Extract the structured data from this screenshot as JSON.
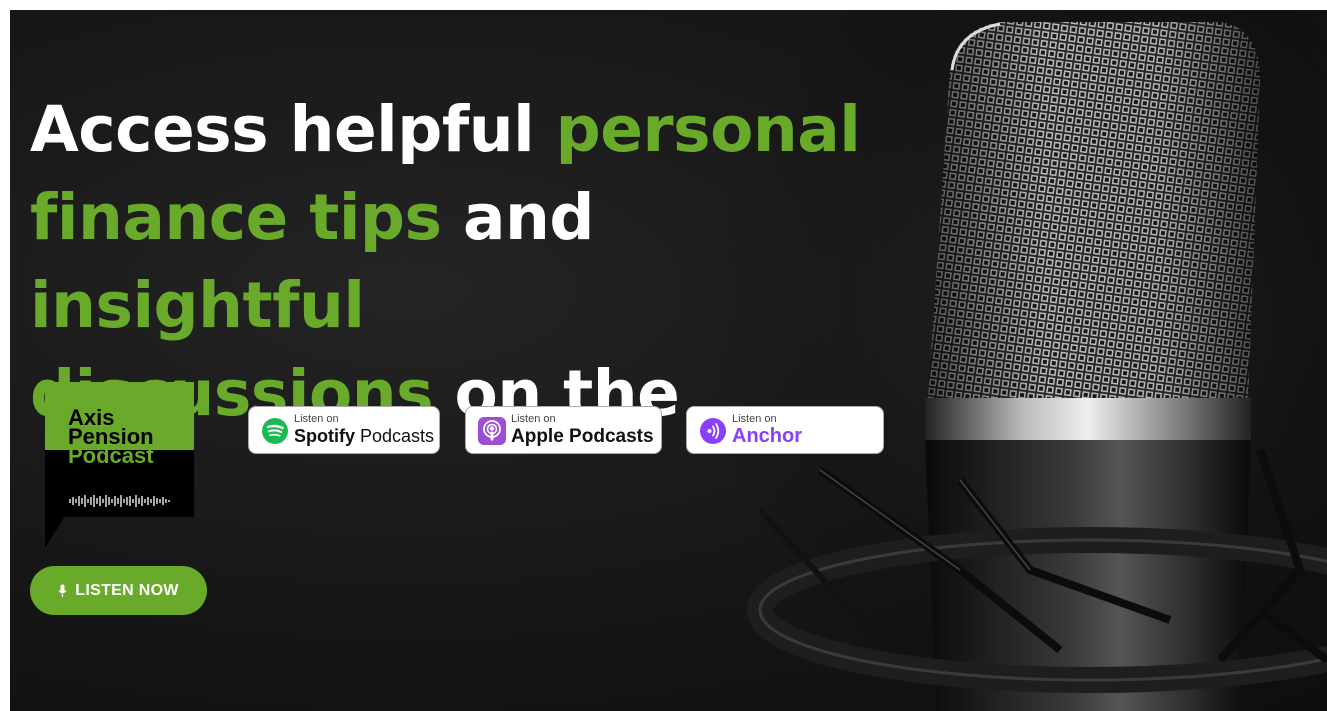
{
  "headline": {
    "w1": "Access helpful ",
    "g1": "personal",
    "g2": "finance tips",
    "w2": " and ",
    "g3": "insightful",
    "g4": "discussions",
    "w3": " on the"
  },
  "logo": {
    "line1": "Axis",
    "line2": "Pension",
    "line3": "Podcast"
  },
  "badges": {
    "spotify": {
      "small": "Listen on",
      "brand": "Spotify",
      "rest": " Podcasts"
    },
    "apple": {
      "small": "Listen on",
      "big": "Apple Podcasts"
    },
    "anchor": {
      "small": "Listen on",
      "big": "Anchor"
    }
  },
  "cta": {
    "label": "LISTEN NOW"
  },
  "colors": {
    "accent_green": "#6aaa2a",
    "background": "#161616",
    "anchor_purple": "#8940fa",
    "spotify_green": "#1db954",
    "apple_purple": "#9c4fd4"
  }
}
